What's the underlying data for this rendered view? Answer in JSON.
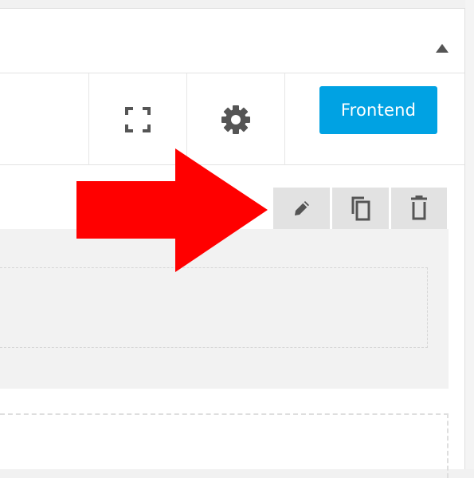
{
  "toolbar": {
    "frontend_label": "Frontend",
    "fullscreen_icon": "fullscreen-icon",
    "settings_icon": "gear-icon"
  },
  "element_controls": {
    "icons": [
      "pencil-icon",
      "copy-icon",
      "trash-icon"
    ]
  },
  "annotation": {
    "arrow_color": "#ff0000"
  },
  "colors": {
    "accent": "#00a2e3",
    "control_bg": "#e2e2e2",
    "icon": "#555555"
  }
}
